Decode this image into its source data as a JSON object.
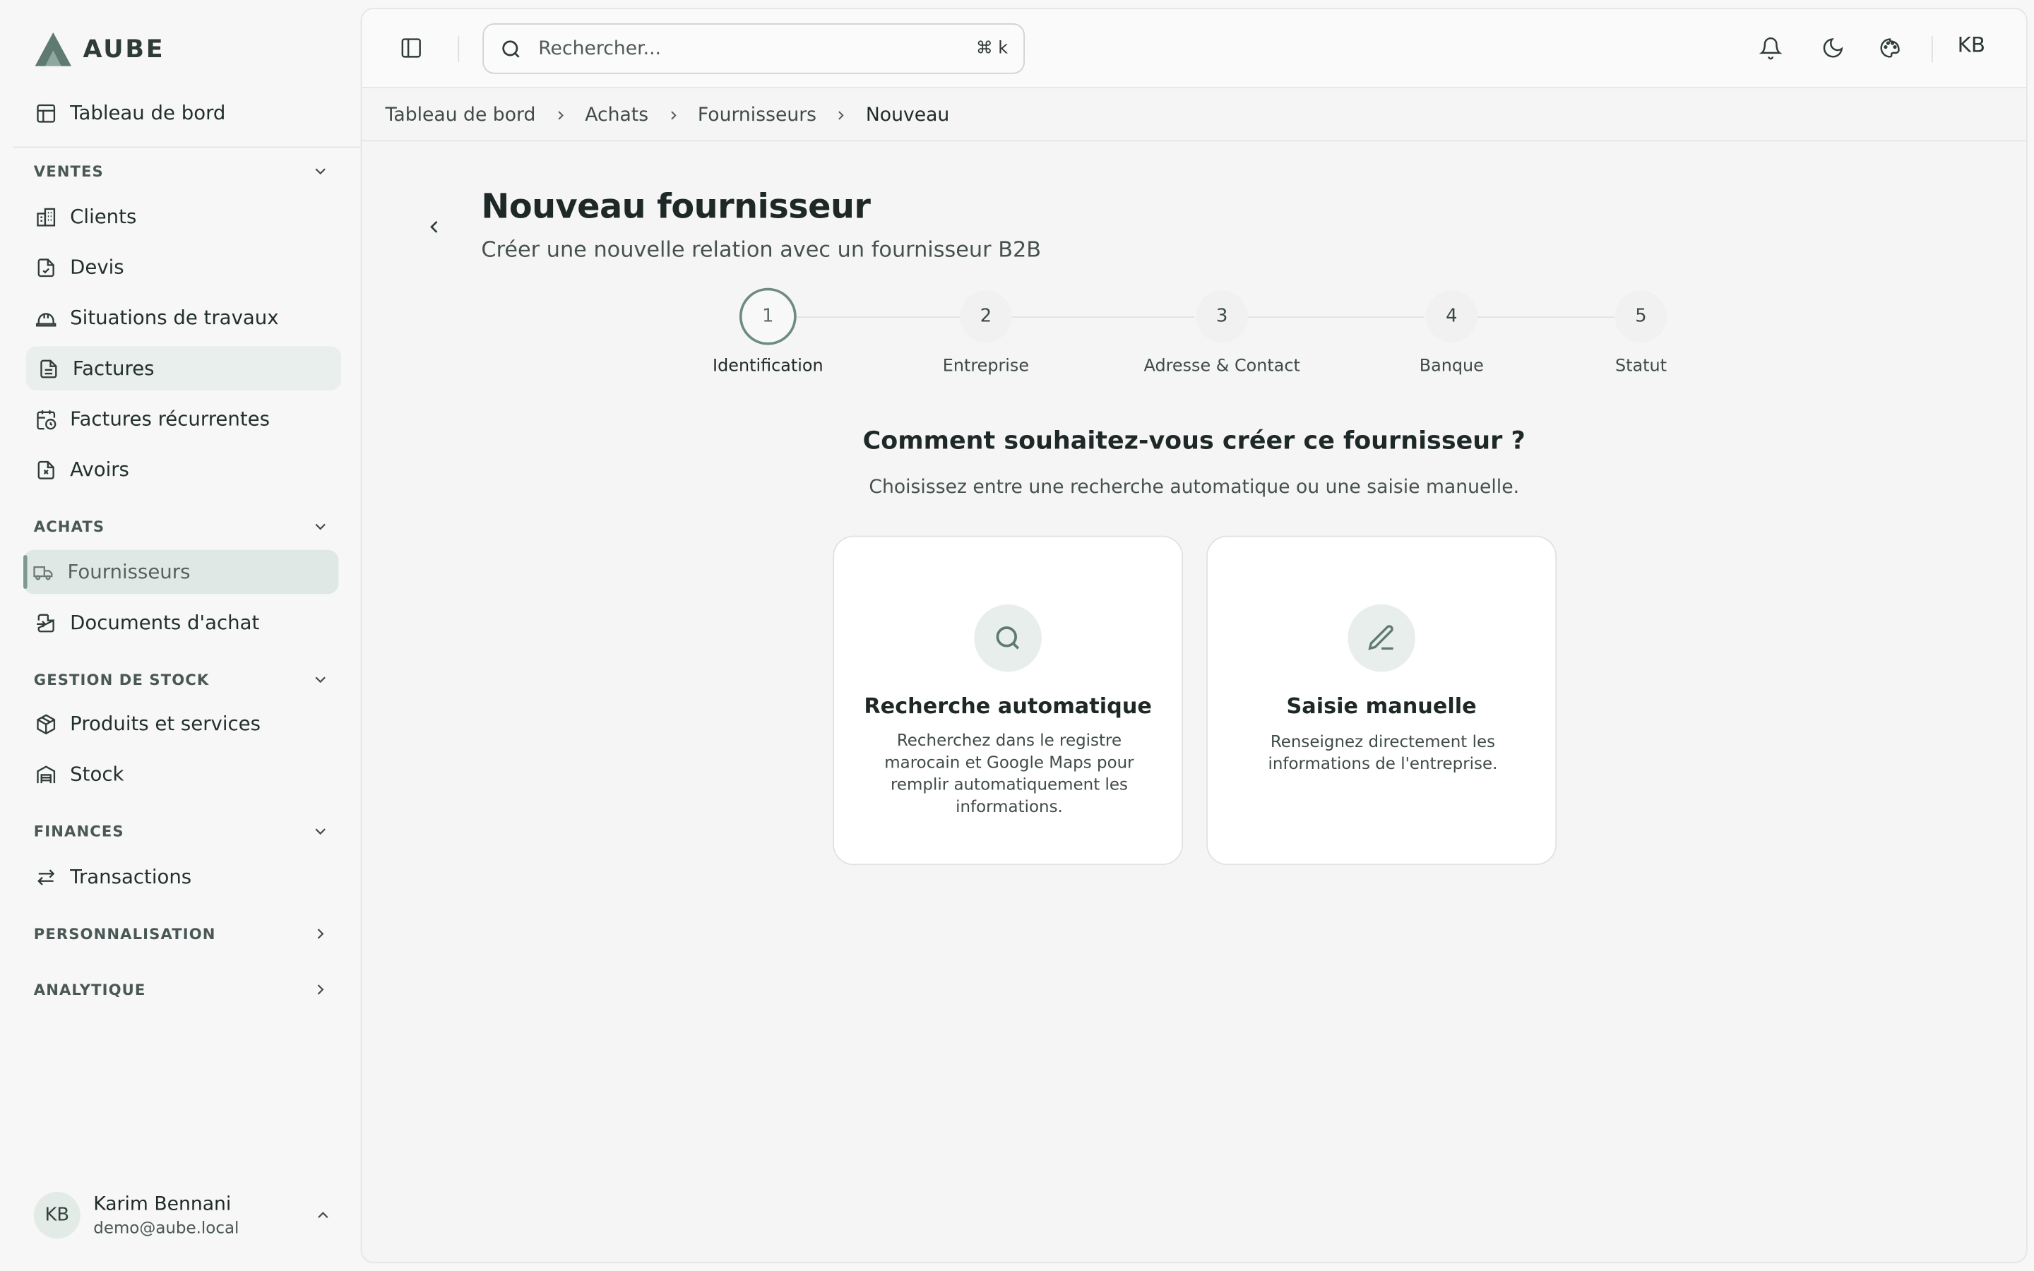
{
  "app": {
    "logo_text": "AUBE",
    "accent": "#6f8b81"
  },
  "sidebar": {
    "dashboard": "Tableau de bord",
    "sections": {
      "ventes": "VENTES",
      "achats": "ACHATS",
      "stock": "GESTION DE STOCK",
      "finances": "FINANCES",
      "perso": "PERSONNALISATION",
      "analytique": "ANALYTIQUE"
    },
    "items": {
      "clients": "Clients",
      "devis": "Devis",
      "situations": "Situations de travaux",
      "factures": "Factures",
      "factures_rec": "Factures récurrentes",
      "avoirs": "Avoirs",
      "fournisseurs": "Fournisseurs",
      "documents_achat": "Documents d'achat",
      "produits": "Produits et services",
      "stock": "Stock",
      "transactions": "Transactions"
    },
    "user": {
      "initials": "KB",
      "name": "Karim Bennani",
      "email": "demo@aube.local"
    }
  },
  "topbar": {
    "search_placeholder": "Rechercher...",
    "shortcut": "⌘ k",
    "avatar_initials": "KB"
  },
  "breadcrumb": [
    "Tableau de bord",
    "Achats",
    "Fournisseurs",
    "Nouveau"
  ],
  "page": {
    "title": "Nouveau fournisseur",
    "subtitle": "Créer une nouvelle relation avec un fournisseur B2B"
  },
  "stepper": {
    "current": 1,
    "steps": [
      {
        "num": "1",
        "label": "Identification"
      },
      {
        "num": "2",
        "label": "Entreprise"
      },
      {
        "num": "3",
        "label": "Adresse & Contact"
      },
      {
        "num": "4",
        "label": "Banque"
      },
      {
        "num": "5",
        "label": "Statut"
      }
    ]
  },
  "question": {
    "title": "Comment souhaitez-vous créer ce fournisseur ?",
    "subtitle": "Choisissez entre une recherche automatique ou une saisie manuelle."
  },
  "options": {
    "auto": {
      "icon": "search-icon",
      "title": "Recherche automatique",
      "desc": "Recherchez dans le registre marocain et Google Maps pour remplir automatiquement les informations."
    },
    "manual": {
      "icon": "pencil-icon",
      "title": "Saisie manuelle",
      "desc": "Renseignez directement les informations de l'entreprise."
    }
  }
}
